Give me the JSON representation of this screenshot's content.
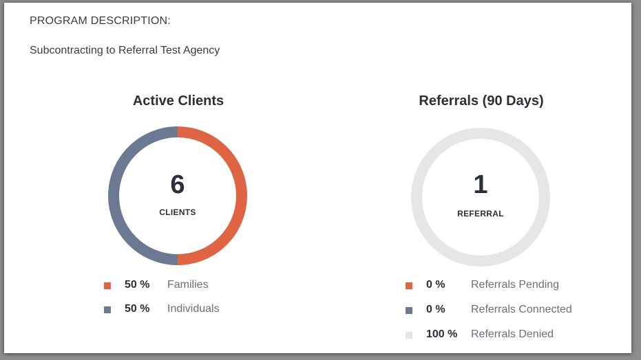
{
  "program": {
    "label": "PROGRAM DESCRIPTION:",
    "description": "Subcontracting to Referral Test Agency"
  },
  "colors": {
    "families": "#df6443",
    "individuals": "#6c7993",
    "denied": "#e6e6e6"
  },
  "chart_data": [
    {
      "type": "pie",
      "title": "Active Clients",
      "center_value": "6",
      "center_label": "CLIENTS",
      "slices": [
        {
          "label": "Families",
          "value": 50,
          "percent_text": "50 %",
          "color": "#df6443"
        },
        {
          "label": "Individuals",
          "value": 50,
          "percent_text": "50 %",
          "color": "#6c7993"
        }
      ]
    },
    {
      "type": "pie",
      "title": "Referrals (90 Days)",
      "center_value": "1",
      "center_label": "REFERRAL",
      "slices": [
        {
          "label": "Referrals Pending",
          "value": 0,
          "percent_text": "0 %",
          "color": "#df6443"
        },
        {
          "label": "Referrals Connected",
          "value": 0,
          "percent_text": "0 %",
          "color": "#6c7993"
        },
        {
          "label": "Referrals Denied",
          "value": 100,
          "percent_text": "100 %",
          "color": "#e6e6e6"
        }
      ]
    }
  ]
}
